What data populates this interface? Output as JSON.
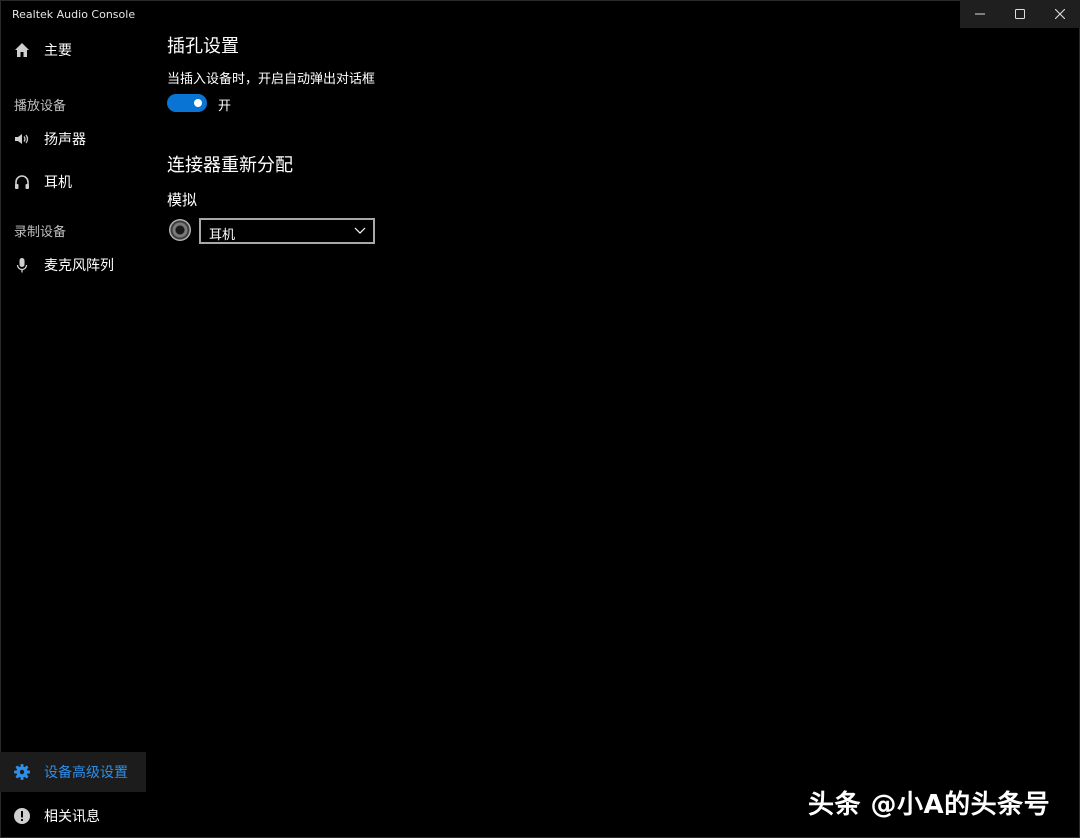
{
  "window": {
    "title": "Realtek Audio Console"
  },
  "sidebar": {
    "home": "主要",
    "playback_header": "播放设备",
    "speakers": "扬声器",
    "headphones": "耳机",
    "recording_header": "录制设备",
    "mic_array": "麦克风阵列",
    "advanced": "设备高级设置",
    "info": "相关讯息"
  },
  "main": {
    "jack_settings_title": "插孔设置",
    "popup_description": "当插入设备时，开启自动弹出对话框",
    "popup_toggle": {
      "state_label": "开",
      "on": true
    },
    "connector_title": "连接器重新分配",
    "analog_label": "模拟",
    "connector_select": {
      "value": "耳机"
    }
  },
  "watermark": "头条 @小A的头条号",
  "colors": {
    "accent": "#0a74d4",
    "active_text": "#2f8ee6",
    "background": "#000000"
  }
}
